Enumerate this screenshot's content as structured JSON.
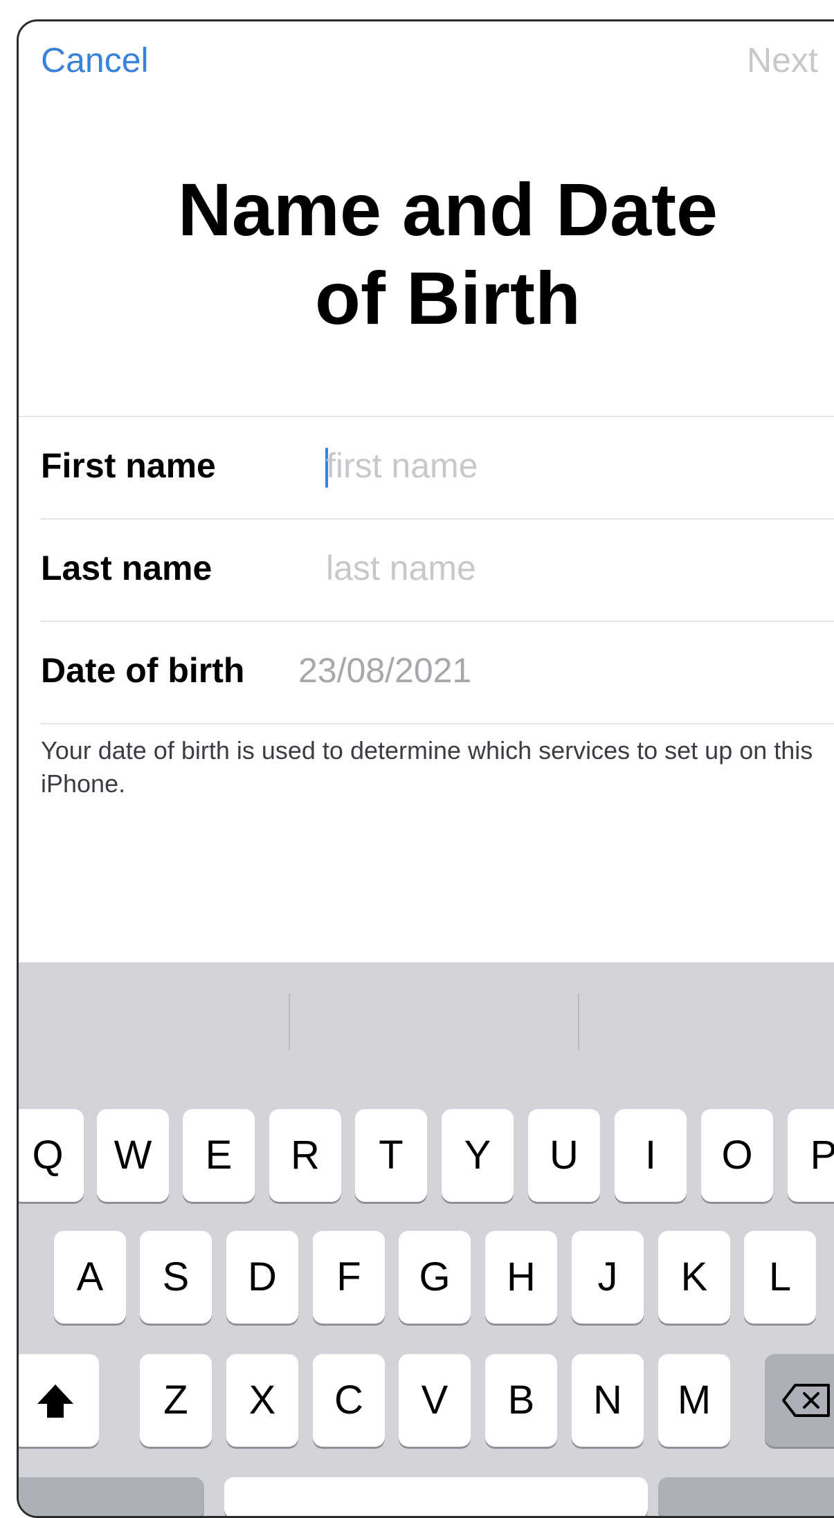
{
  "navbar": {
    "cancel_label": "Cancel",
    "next_label": "Next"
  },
  "title": {
    "line1": "Name and Date",
    "line2": "of Birth"
  },
  "form": {
    "first_name": {
      "label": "First name",
      "value": "",
      "placeholder": "first name"
    },
    "last_name": {
      "label": "Last name",
      "value": "",
      "placeholder": "last name"
    },
    "date_of_birth": {
      "label": "Date of birth",
      "value": "23/08/2021"
    }
  },
  "footnote": "Your date of birth is used to determine which services to set up on this iPhone.",
  "keyboard": {
    "row1": [
      "Q",
      "W",
      "E",
      "R",
      "T",
      "Y",
      "U",
      "I",
      "O",
      "P"
    ],
    "row2": [
      "A",
      "S",
      "D",
      "F",
      "G",
      "H",
      "J",
      "K",
      "L"
    ],
    "row3": [
      "Z",
      "X",
      "C",
      "V",
      "B",
      "N",
      "M"
    ],
    "shift_icon": "shift-arrow-icon",
    "delete_icon": "backspace-icon"
  },
  "colors": {
    "accent": "#3a82d9",
    "disabled": "#c7c7cc",
    "keyboard_bg": "#d2d4da"
  }
}
